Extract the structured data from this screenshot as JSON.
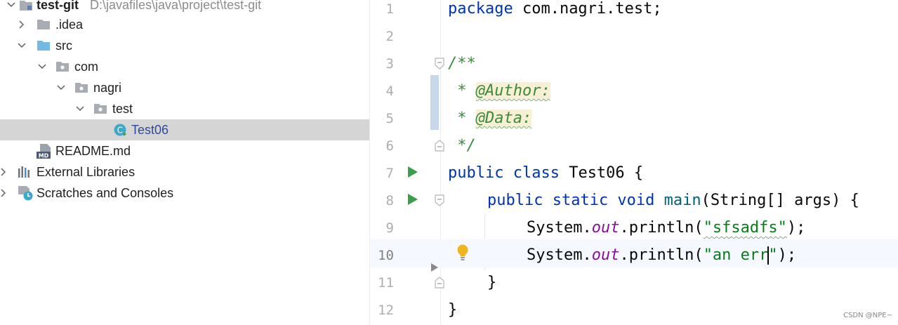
{
  "project_tree": {
    "root": {
      "label": "test-git",
      "path": "D:\\javafiles\\java\\project\\test-git"
    },
    "items": [
      {
        "label": ".idea"
      },
      {
        "label": "src"
      },
      {
        "label": "com"
      },
      {
        "label": "nagri"
      },
      {
        "label": "test"
      },
      {
        "label": "Test06",
        "selected": true
      },
      {
        "label": "README.md"
      },
      {
        "label": "External Libraries"
      },
      {
        "label": "Scratches and Consoles"
      }
    ],
    "md_badge": "MD",
    "class_badge": "C"
  },
  "editor": {
    "current_line": 10,
    "line_numbers": [
      "1",
      "2",
      "3",
      "4",
      "5",
      "6",
      "7",
      "8",
      "9",
      "10",
      "11",
      "12"
    ],
    "code": {
      "l1_kw": "package",
      "l1_rest": " com.nagri.test;",
      "l3": "/**",
      "l4_star": " * ",
      "l4_tag": "@Author:",
      "l5_star": " * ",
      "l5_tag": "@Data:",
      "l6": " */",
      "l7_kw": "public class",
      "l7_rest": " Test06 {",
      "l8_kw": "public static void",
      "l8_fn": "main",
      "l8_rest": "(String[] args) {",
      "l9_sys": "System.",
      "l9_out": "out",
      "l9_call": ".println(",
      "l9_str": "\"sfsadfs\"",
      "l9_end": ");",
      "l10_sys": "System.",
      "l10_out": "out",
      "l10_call": ".println(",
      "l10_str_a": "\"an err",
      "l10_str_b": "\"",
      "l10_end": ");",
      "l11": "}",
      "l12": "}"
    }
  },
  "watermark": "CSDN @NPE~",
  "colors": {
    "keyword": "#0033b3",
    "comment": "#3d8a3d",
    "string": "#067d17",
    "field": "#871094",
    "method": "#00627a",
    "selection": "#d5d5d5",
    "current_line": "#f5f8fe",
    "run": "#3b9e4a",
    "folder": "#a8adb3",
    "source_folder": "#74b9e0"
  }
}
